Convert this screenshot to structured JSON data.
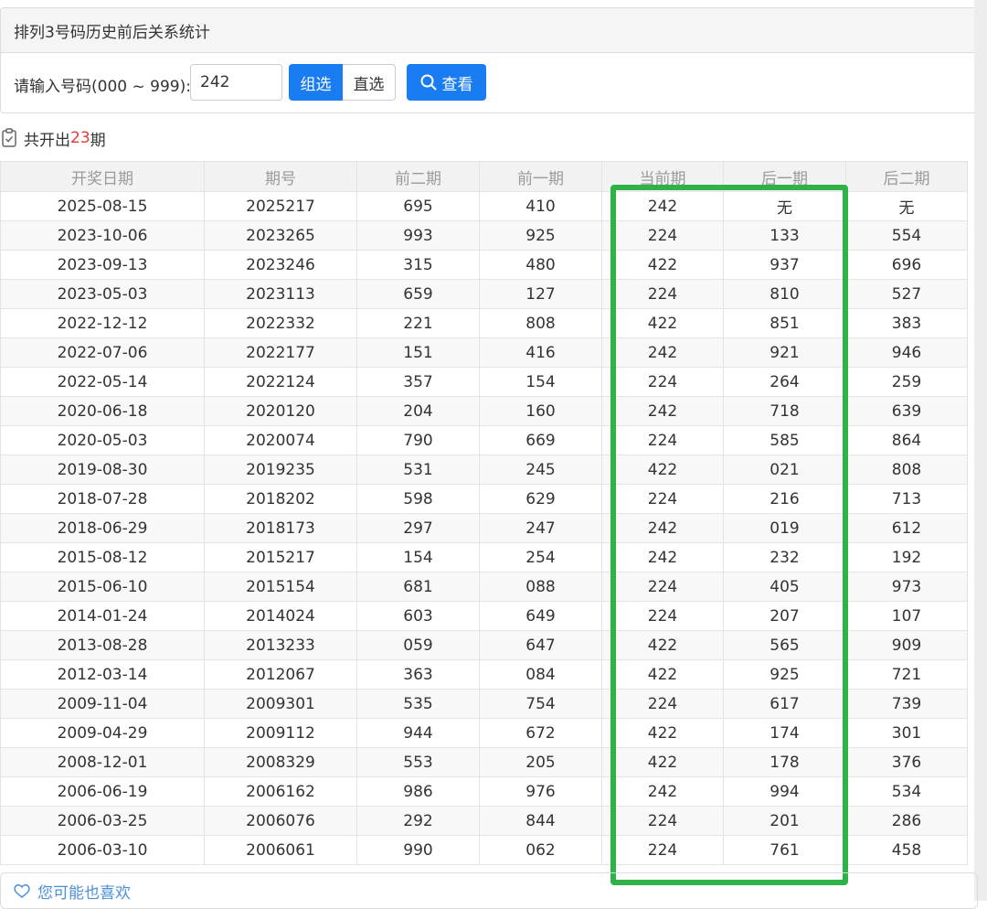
{
  "panel": {
    "title": "排列3号码历史前后关系统计",
    "input_label": "请输入号码(000 ~ 999):",
    "input_value": "242",
    "mode_group": "组选",
    "mode_direct": "直选",
    "view_button": "查看",
    "view_icon": "search-icon"
  },
  "summary": {
    "prefix": "共开出",
    "count": "23",
    "suffix": "期",
    "icon": "clipboard-check-icon"
  },
  "table": {
    "headers": [
      "开奖日期",
      "期号",
      "前二期",
      "前一期",
      "当前期",
      "后一期",
      "后二期"
    ],
    "rows": [
      [
        "2025-08-15",
        "2025217",
        "695",
        "410",
        "242",
        "无",
        "无"
      ],
      [
        "2023-10-06",
        "2023265",
        "993",
        "925",
        "224",
        "133",
        "554"
      ],
      [
        "2023-09-13",
        "2023246",
        "315",
        "480",
        "422",
        "937",
        "696"
      ],
      [
        "2023-05-03",
        "2023113",
        "659",
        "127",
        "224",
        "810",
        "527"
      ],
      [
        "2022-12-12",
        "2022332",
        "221",
        "808",
        "422",
        "851",
        "383"
      ],
      [
        "2022-07-06",
        "2022177",
        "151",
        "416",
        "242",
        "921",
        "946"
      ],
      [
        "2022-05-14",
        "2022124",
        "357",
        "154",
        "224",
        "264",
        "259"
      ],
      [
        "2020-06-18",
        "2020120",
        "204",
        "160",
        "242",
        "718",
        "639"
      ],
      [
        "2020-05-03",
        "2020074",
        "790",
        "669",
        "224",
        "585",
        "864"
      ],
      [
        "2019-08-30",
        "2019235",
        "531",
        "245",
        "422",
        "021",
        "808"
      ],
      [
        "2018-07-28",
        "2018202",
        "598",
        "629",
        "224",
        "216",
        "713"
      ],
      [
        "2018-06-29",
        "2018173",
        "297",
        "247",
        "242",
        "019",
        "612"
      ],
      [
        "2015-08-12",
        "2015217",
        "154",
        "254",
        "242",
        "232",
        "192"
      ],
      [
        "2015-06-10",
        "2015154",
        "681",
        "088",
        "224",
        "405",
        "973"
      ],
      [
        "2014-01-24",
        "2014024",
        "603",
        "649",
        "224",
        "207",
        "107"
      ],
      [
        "2013-08-28",
        "2013233",
        "059",
        "647",
        "422",
        "565",
        "909"
      ],
      [
        "2012-03-14",
        "2012067",
        "363",
        "084",
        "422",
        "925",
        "721"
      ],
      [
        "2009-11-04",
        "2009301",
        "535",
        "754",
        "224",
        "617",
        "739"
      ],
      [
        "2009-04-29",
        "2009112",
        "944",
        "672",
        "422",
        "174",
        "301"
      ],
      [
        "2008-12-01",
        "2008329",
        "553",
        "205",
        "422",
        "178",
        "376"
      ],
      [
        "2006-06-19",
        "2006162",
        "986",
        "976",
        "242",
        "994",
        "534"
      ],
      [
        "2006-03-25",
        "2006076",
        "292",
        "844",
        "224",
        "201",
        "286"
      ],
      [
        "2006-03-10",
        "2006061",
        "990",
        "062",
        "224",
        "761",
        "458"
      ]
    ]
  },
  "highlight_color": "#2fb247",
  "accent_color": "#1a7cf2",
  "count_color": "#e53935",
  "footer": {
    "label": "您可能也喜欢",
    "icon": "heart-icon"
  }
}
